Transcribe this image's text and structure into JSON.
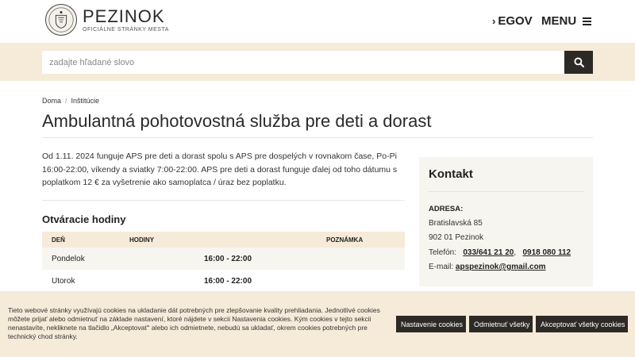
{
  "header": {
    "brand_name": "PEZINOK",
    "brand_subtitle": "OFICIÁLNE STRÁNKY MESTA",
    "nav_egov": "EGOV",
    "nav_menu": "MENU"
  },
  "search": {
    "placeholder": "zadajte hľadané slovo",
    "value": ""
  },
  "breadcrumb": [
    "Doma",
    "Inštitúcie"
  ],
  "page": {
    "title": "Ambulantná pohotovostná služba pre deti a dorast",
    "intro": "Od 1.11. 2024 funguje APS pre deti a dorast spolu s APS pre dospelých v rovnakom čase, Po-Pi 16:00-22:00, víkendy a sviatky 7:00-22:00.  APS pre deti a dorast funguje ďalej od toho dátumu s poplatkom 12 € za vyšetrenie ako samoplatca / úraz bez poplatku."
  },
  "hours": {
    "title": "Otváracie hodiny",
    "columns": [
      "DEŇ",
      "HODINY",
      "POZNÁMKA"
    ],
    "rows": [
      {
        "day": "Pondelok",
        "hours": "16:00 - 22:00",
        "note": ""
      },
      {
        "day": "Utorok",
        "hours": "16:00 - 22:00",
        "note": ""
      }
    ]
  },
  "contact": {
    "title": "Kontakt",
    "address_label": "ADRESA:",
    "street": "Bratislavská 85",
    "city": "902 01 Pezinok",
    "phone_label": "Telefón:",
    "phone1": "033/641 21 20",
    "phone_sep": ",",
    "phone2": "0918 080 112",
    "email_label": "E-mail:",
    "email": "apspezinok@gmail.com"
  },
  "cookies": {
    "text": "Tieto webové stránky využívajú cookies na ukladanie dát potrebných pre zlepšovanie kvality prehliadania. Jednotlivé cookies môžete prijať alebo odmietnuť na základe nastavení, ktoré nájdete v sekcii Nastavenia cookies. Kým cookies v tejto sekcii nenastavíte, nekliknete na tlačidlo „Akceptovať“ alebo ich odmietnete, nebudú sa ukladať, okrem cookies potrebných pre technický chod stránky.",
    "settings_label": "Nastavenie cookies",
    "reject_label": "Odmietnuť všetky",
    "accept_label": "Akceptovať všetky cookies"
  },
  "icons": {
    "logo": "city-crest-icon",
    "egov": "chevron-right-icon",
    "menu": "hamburger-icon",
    "search": "search-icon"
  },
  "colors": {
    "accent_band": "#f6ead9",
    "dark_button": "#2d2a26",
    "panel": "#f7f5f0"
  }
}
